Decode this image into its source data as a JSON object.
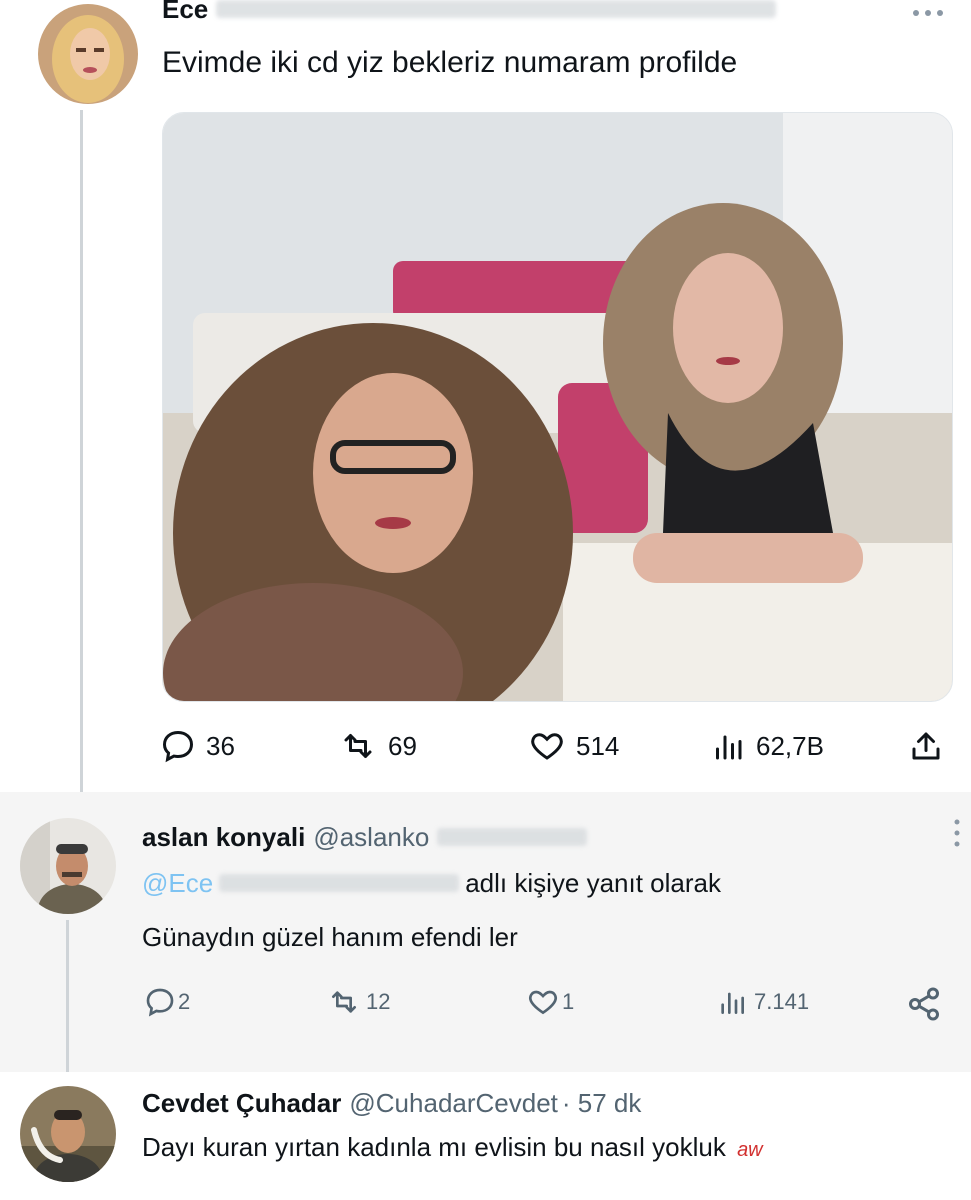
{
  "tweet": {
    "author_name": "Ece",
    "text": "Evimde iki cd yiz bekleriz numaram profilde",
    "stats": {
      "replies": "36",
      "retweets": "69",
      "likes": "514",
      "views": "62,7B"
    }
  },
  "replies": [
    {
      "author_name": "aslan konyali",
      "handle": "@aslanko",
      "reply_to_handle": "@Ece",
      "reply_to_suffix": "adlı kişiye yanıt olarak",
      "text": "Günaydın güzel hanım efendi ler",
      "stats": {
        "replies": "2",
        "retweets": "12",
        "likes": "1",
        "views": "7.141"
      }
    },
    {
      "author_name": "Cevdet Çuhadar",
      "handle": "@CuhadarCevdet",
      "time": "· 57 dk",
      "text": "Dayı kuran yırtan kadınla mı evlisin bu nasıl yokluk",
      "text_tail": "aw"
    }
  ],
  "icons": {
    "reply": "speech-bubble-icon",
    "retweet": "retweet-icon",
    "like": "heart-icon",
    "views": "bar-chart-icon",
    "share": "share-upload-icon",
    "share_alt": "share-nodes-icon",
    "more": "more-dots-icon"
  },
  "colors": {
    "text": "#0f1419",
    "muted": "#536471",
    "reply_background": "#f5f5f5",
    "thread_line": "#cfd4d8"
  }
}
